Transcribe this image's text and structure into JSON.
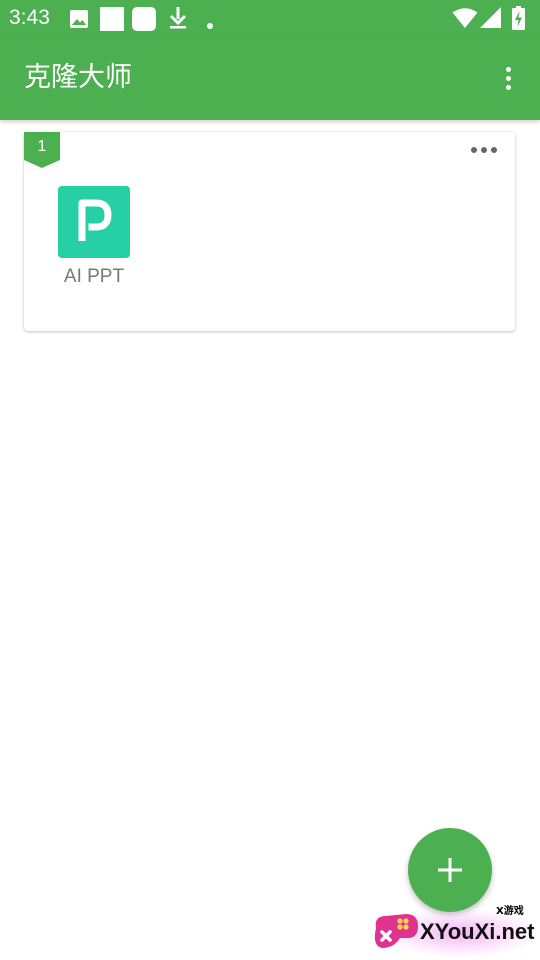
{
  "status_bar": {
    "time": "3:43",
    "left_icons": [
      "image-icon",
      "square-notification-icon",
      "rounded-square-notification-icon",
      "download-icon",
      "dot-icon"
    ],
    "right_icons": [
      "wifi-icon",
      "cellular-signal-icon",
      "battery-charging-icon"
    ]
  },
  "app_bar": {
    "title": "克隆大师",
    "menu_icon": "more-vert-icon"
  },
  "groups": [
    {
      "number": "1",
      "menu_icon": "more-horiz-icon",
      "apps": [
        {
          "label": "AI PPT",
          "icon_letter": "P",
          "icon_color": "#26cfa6"
        }
      ]
    }
  ],
  "fab": {
    "icon": "plus-icon"
  },
  "watermark": {
    "small_text": "X游戏",
    "text": "XYouXi.net"
  },
  "colors": {
    "primary": "#4caf50",
    "app_icon": "#26cfa6",
    "label_gray": "#777777"
  }
}
